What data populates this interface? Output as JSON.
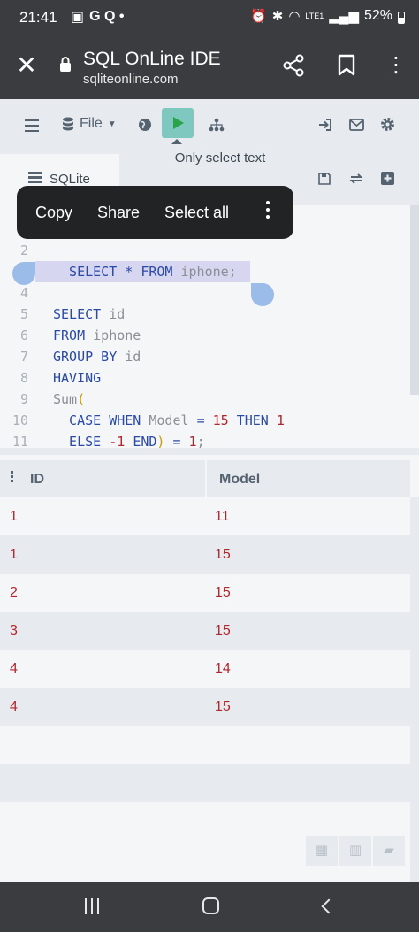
{
  "status": {
    "time": "21:41",
    "left_icons": "G Q •",
    "battery": "52%",
    "network": "LTE1"
  },
  "browser": {
    "title": "SQL OnLine IDE",
    "url": "sqliteonline.com"
  },
  "toolbar": {
    "file_label": "File",
    "tooltip": "Only select text"
  },
  "db": {
    "tab_label": "SQLite"
  },
  "context_menu": {
    "copy": "Copy",
    "share": "Share",
    "select_all": "Select all"
  },
  "editor": {
    "lines": [
      {
        "n": "2",
        "segments": []
      },
      {
        "n": "",
        "segments": [
          [
            "kw",
            "  SELECT "
          ],
          [
            "kw",
            "* "
          ],
          [
            "kw",
            "FROM "
          ],
          [
            "plain",
            "iphone;"
          ]
        ]
      },
      {
        "n": "4",
        "segments": []
      },
      {
        "n": "5",
        "segments": [
          [
            "kw",
            "SELECT "
          ],
          [
            "plain",
            "id"
          ]
        ]
      },
      {
        "n": "6",
        "segments": [
          [
            "kw",
            "FROM "
          ],
          [
            "plain",
            "iphone"
          ]
        ]
      },
      {
        "n": "7",
        "segments": [
          [
            "kw",
            "GROUP BY "
          ],
          [
            "plain",
            "id"
          ]
        ]
      },
      {
        "n": "8",
        "segments": [
          [
            "kw",
            "HAVING"
          ]
        ]
      },
      {
        "n": "9",
        "segments": [
          [
            "plain",
            "Sum"
          ],
          [
            "paren",
            "("
          ]
        ]
      },
      {
        "n": "10",
        "segments": [
          [
            "kw",
            "  CASE WHEN "
          ],
          [
            "plain",
            "Model "
          ],
          [
            "kw",
            "= "
          ],
          [
            "num-lit",
            "15 "
          ],
          [
            "kw",
            "THEN "
          ],
          [
            "num-lit",
            "1"
          ]
        ]
      },
      {
        "n": "11",
        "segments": [
          [
            "kw",
            "  ELSE "
          ],
          [
            "num-lit",
            "-1 "
          ],
          [
            "kw",
            "END"
          ],
          [
            "paren",
            ")"
          ],
          [
            "kw",
            " = "
          ],
          [
            "num-lit",
            "1"
          ],
          [
            "plain",
            ";"
          ]
        ]
      }
    ]
  },
  "results": {
    "columns": [
      "ID",
      "Model"
    ],
    "rows": [
      [
        "1",
        "11"
      ],
      [
        "1",
        "15"
      ],
      [
        "2",
        "15"
      ],
      [
        "3",
        "15"
      ],
      [
        "4",
        "14"
      ],
      [
        "4",
        "15"
      ]
    ]
  },
  "colors": {
    "accent": "#7fc8c0",
    "run_icon": "#2aa34a",
    "keyword": "#2a4aa8",
    "value_red": "#b3252d"
  }
}
